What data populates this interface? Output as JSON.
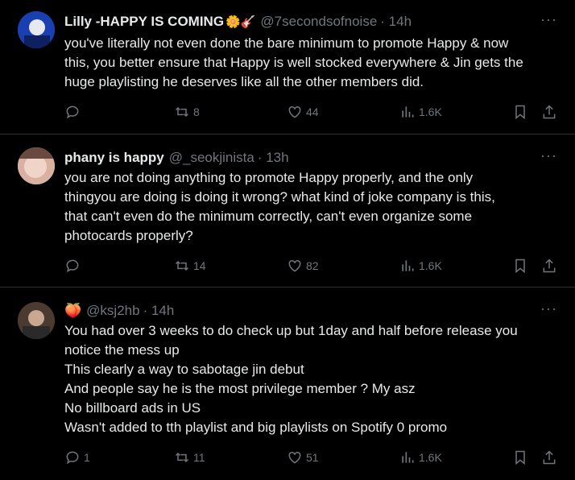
{
  "tweets": [
    {
      "name": "Lilly -HAPPY IS COMING",
      "emoji": "🌼🎸",
      "handle": "@7secondsofnoise",
      "time": "· 14h",
      "lines": [
        "you've literally not even done the bare minimum to promote  Happy & now",
        "this, you better ensure that Happy is well stocked everywhere & Jin gets the",
        "huge playlisting he deserves like all the other members did."
      ],
      "replies": "",
      "retweets": "8",
      "likes": "44",
      "views": "1.6K",
      "avatar_color": "#1f3fa8"
    },
    {
      "name": "phany is happy",
      "emoji": "",
      "handle": "@_seokjinista",
      "time": "· 13h",
      "lines": [
        "you are not doing anything to promote Happy properly, and the only",
        "thingyou are doing is doing it wrong? what kind of joke company is this,",
        "that can't even do the minimum correctly, can't even organize some",
        "photocards properly?"
      ],
      "replies": "",
      "retweets": "14",
      "likes": "82",
      "views": "1.6K",
      "avatar_color": "#c99a8c"
    },
    {
      "name": "",
      "emoji": "🍑",
      "handle": "@ksj2hb",
      "time": "· 14h",
      "lines": [
        "You had over 3 weeks to do check up but 1day and half before release you",
        "notice the mess up",
        "This clearly a way to sabotage jin debut",
        "And people say he is the most privilege member ? My asz",
        "No billboard ads in US",
        "Wasn't added to tth playlist and big playlists on Spotify 0 promo"
      ],
      "replies": "1",
      "retweets": "11",
      "likes": "51",
      "views": "1.6K",
      "avatar_color": "#5a4a40"
    }
  ],
  "more_label": "···",
  "icons": [
    "reply-icon",
    "retweet-icon",
    "like-icon",
    "views-icon",
    "bookmark-icon",
    "share-icon",
    "more-icon"
  ]
}
